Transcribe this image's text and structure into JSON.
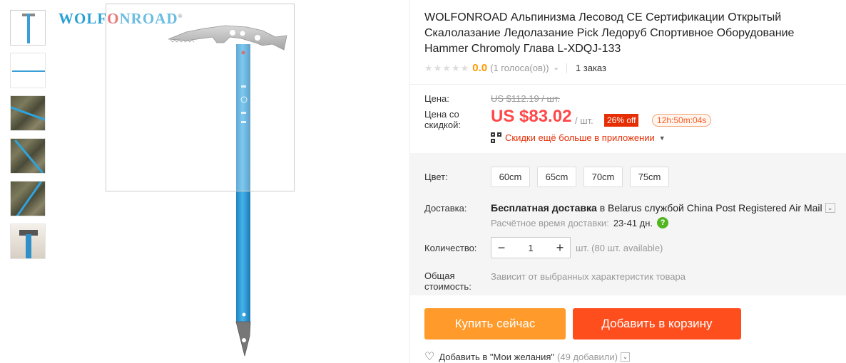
{
  "logo": {
    "prefix": "WOLF",
    "o": "O",
    "suffix": "NROAD",
    "reg": "®"
  },
  "product": {
    "title": "WOLFONROAD Альпинизма Лесовод CE Сертификации Открытый Скалолазание Ледолазание Pick Ледоруб Спортивное Оборудование Hammer Chromoly Глава L-XDQJ-133",
    "stars": "★★★★★",
    "rating": "0.0",
    "votes": "(1 голоса(ов))",
    "orders": "1 заказ"
  },
  "price": {
    "label": "Цена:",
    "old": "US $112.19 / шт.",
    "discount_label": "Цена со скидкой:",
    "current": "US $83.02",
    "per": "/ шт.",
    "discount": "26% off",
    "timer": "12h:50m:04s",
    "app_text": "Скидки ещё больше в приложении"
  },
  "options": {
    "color_label": "Цвет:",
    "values": [
      "60cm",
      "65cm",
      "70cm",
      "75cm"
    ]
  },
  "shipping": {
    "label": "Доставка:",
    "free": "Бесплатная доставка",
    "in": " в ",
    "country": "Belarus",
    "service": " службой China Post Registered Air Mail",
    "time_label": "Расчётное время доставки:",
    "days": "23-41 дн."
  },
  "quantity": {
    "label": "Количество:",
    "value": "1",
    "minus": "−",
    "plus": "+",
    "note": "шт. (80 шт. available)"
  },
  "total": {
    "label": "Общая стоимость:",
    "note": "Зависит от выбранных характеристик товара"
  },
  "actions": {
    "buy": "Купить сейчас",
    "cart": "Добавить в корзину",
    "wish": "Добавить в \"Мои желания\"",
    "wish_count": "(49 добавили)"
  },
  "icons": {
    "heart": "heart-icon",
    "qr": "qr-code-icon",
    "help": "help-icon"
  }
}
